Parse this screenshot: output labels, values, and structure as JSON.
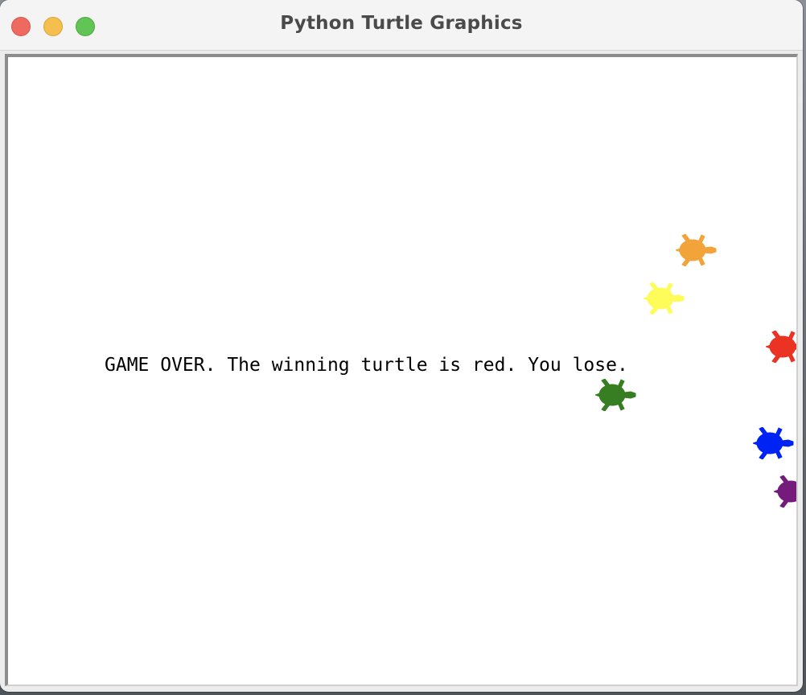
{
  "window": {
    "title": "Python Turtle Graphics"
  },
  "canvas": {
    "message": "GAME OVER. The winning turtle is red. You lose."
  },
  "turtles": [
    {
      "name": "orange",
      "color": "#f2a33a"
    },
    {
      "name": "yellow",
      "color": "#fdfc58"
    },
    {
      "name": "red",
      "color": "#ea3323"
    },
    {
      "name": "green",
      "color": "#377d22"
    },
    {
      "name": "blue",
      "color": "#0023f5"
    },
    {
      "name": "purple",
      "color": "#741b7c"
    }
  ]
}
